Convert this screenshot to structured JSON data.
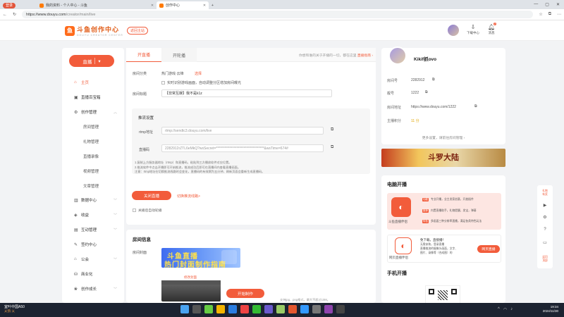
{
  "browser": {
    "profile_label": "登录",
    "tabs": [
      {
        "title": "我的资料 - 个人中心 - 斗鱼"
      },
      {
        "title": "创作中心"
      }
    ],
    "url_host": "https://www.douyu.com",
    "url_path": "/creator/main/live"
  },
  "header": {
    "logo_name": "斗鱼创作中心",
    "logo_sub": "DOUYU CREATOR CENTER",
    "back_label": "返回主站",
    "download_label": "下载中心",
    "message_label": "消息",
    "message_badge": "2"
  },
  "sidebar": {
    "live_button": "直播",
    "items": [
      {
        "label": "主页",
        "icon": "home-icon",
        "active": true
      },
      {
        "label": "直播百宝箱",
        "icon": "treasure-icon"
      },
      {
        "label": "创作管理",
        "icon": "gear-icon",
        "expandable": true
      },
      {
        "label": "房间管理",
        "sub": true
      },
      {
        "label": "礼物管理",
        "sub": true
      },
      {
        "label": "直播录像",
        "sub": true
      },
      {
        "label": "视频管理",
        "sub": true
      },
      {
        "label": "文章管理",
        "sub": true
      },
      {
        "label": "数据中心",
        "icon": "chart-icon",
        "expandable": true
      },
      {
        "label": "收益",
        "icon": "wallet-icon",
        "expandable": true
      },
      {
        "label": "互动管理",
        "icon": "chat-icon",
        "expandable": true
      },
      {
        "label": "签约中心",
        "icon": "contract-icon"
      },
      {
        "label": "公会",
        "icon": "guild-icon",
        "expandable": true
      },
      {
        "label": "商业化",
        "icon": "shop-icon"
      },
      {
        "label": "创作成长",
        "icon": "growth-icon",
        "expandable": true
      }
    ]
  },
  "main": {
    "tab_live": "开直播",
    "tab_record": "开轮播",
    "tab_note_prefix": "你想和谁的关于开播的一切，都在这里",
    "tab_note_link": "直播指南 ›",
    "category_label": "房间分类",
    "category_value": "热门游戏·云锋",
    "category_choose": "选择",
    "auto_record": "实时识别游戏画面，自动调整分区增加房间曝光",
    "title_label": "房间标题",
    "title_value": "【非常互娱】我不是k1z",
    "push_header": "推流设置",
    "rtmp_label": "rtmp地址",
    "rtmp_value": "rtmp://sendtc3.douyu.com/live",
    "code_label": "直播码",
    "code_value": "2282912rZTL6eMkQ?wsSecret=***********************************&wsTime=674#",
    "notes": [
      "1.复制上方服务器地址（rtmp）和直播码，粘贴到三方播放软件对应位置。",
      "2.推流软件中点击开播即可开始推流，推流成功后即可在直播间内查看直播画面。",
      "注意：rtmp地址在切换推流线路时会变化，直播码的有效期为五分钟，刷新页面会重新生成直播码。"
    ],
    "close_button": "关闭直播",
    "switch_link": "切换推流线路>",
    "auto_close": "关播后自动轮播"
  },
  "room_info": {
    "title": "房间信息",
    "cover_label": "房间封面",
    "cover_line1": "斗鱼直播",
    "cover_line2": "热门封面制作指南",
    "modify_label": "修改封面",
    "start_button": "开始制作",
    "format_note": "支持jpg、png格式，最大不超过10M。"
  },
  "profile": {
    "name": "Kikif抓ovo",
    "room_id_label": "房间号",
    "room_id": "2282912",
    "alias_label": "靓号",
    "alias": "1222",
    "room_url_label": "房间地址",
    "room_url": "https://www.douyu.com/1222",
    "score_label": "主播积分",
    "score": "11 分",
    "more": "更多设置，请前往房间管理 ›"
  },
  "banner": {
    "text": "斗罗大陆"
  },
  "pc_live": {
    "title": "电脑开播",
    "app_name": "斗鱼直播伴侣",
    "app_tags": [
      "功能",
      "推荐",
      "特色"
    ],
    "app_lines": [
      "专业开播，业主发家创意，开放插件",
      "内置直播助手，礼物提醒，发宝，弹幕",
      "多画面三种分辨率直播，满足各类特色玩法"
    ],
    "web_title": "网页直播伴侣",
    "web_desc": [
      "免下载，直接播！",
      "无需安装，登录直播",
      "直播推流的摄像头画面，文字、",
      "图片、录像等（合成图）的"
    ],
    "web_button": "网页直播",
    "mobile_title": "手机开播"
  },
  "right_bar": {
    "top_label": "礼物\n有奖",
    "bottom_label": "返回\n顶部"
  },
  "taskbar": {
    "app_line1": "室叶中国A50",
    "app_line2": "乂鸽·乂",
    "time": "19:34",
    "date": "2024/11/30"
  },
  "colors": {
    "accent": "#f25c3b",
    "taskbar": "#1c2331"
  }
}
